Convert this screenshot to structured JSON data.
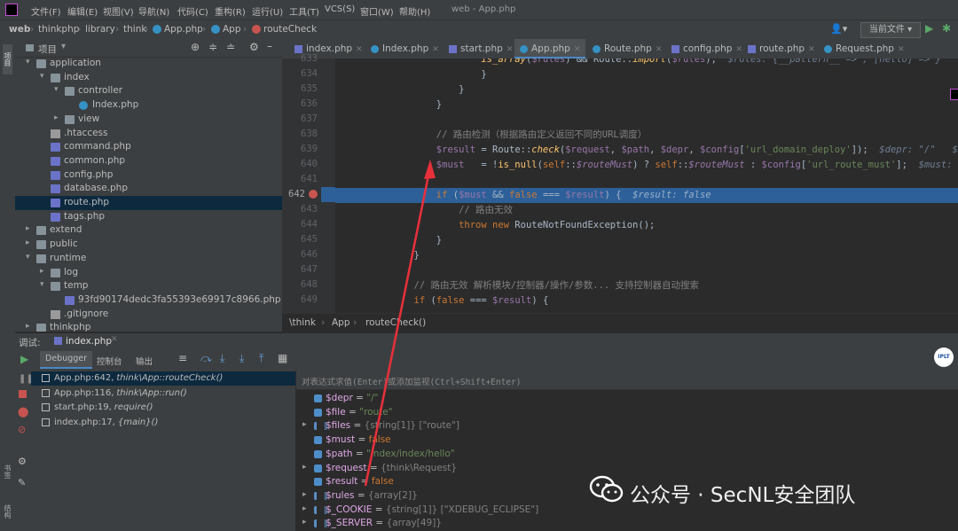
{
  "menu": {
    "items": [
      "文件(F)",
      "编辑(E)",
      "视图(V)",
      "导航(N)",
      "代码(C)",
      "重构(R)",
      "运行(U)",
      "工具(T)",
      "VCS(S)",
      "窗口(W)",
      "帮助(H)"
    ],
    "window_title": "web - App.php"
  },
  "navbar": {
    "crumbs": [
      "web",
      "thinkphp",
      "library",
      "think",
      "App.php",
      "App",
      "routeCheck"
    ],
    "run_config": "当前文件"
  },
  "project": {
    "header": "项目",
    "tree": [
      {
        "label": "application",
        "indent": 2,
        "arrow": "▾",
        "icon": "folder"
      },
      {
        "label": "index",
        "indent": 3,
        "arrow": "▾",
        "icon": "folder"
      },
      {
        "label": "controller",
        "indent": 4,
        "arrow": "▾",
        "icon": "folder"
      },
      {
        "label": "Index.php",
        "indent": 5,
        "arrow": "",
        "icon": "class"
      },
      {
        "label": "view",
        "indent": 4,
        "arrow": "▸",
        "icon": "folder"
      },
      {
        "label": ".htaccess",
        "indent": 3,
        "arrow": "",
        "icon": "text"
      },
      {
        "label": "command.php",
        "indent": 3,
        "arrow": "",
        "icon": "php"
      },
      {
        "label": "common.php",
        "indent": 3,
        "arrow": "",
        "icon": "php"
      },
      {
        "label": "config.php",
        "indent": 3,
        "arrow": "",
        "icon": "php"
      },
      {
        "label": "database.php",
        "indent": 3,
        "arrow": "",
        "icon": "php"
      },
      {
        "label": "route.php",
        "indent": 3,
        "arrow": "",
        "icon": "php",
        "selected": true
      },
      {
        "label": "tags.php",
        "indent": 3,
        "arrow": "",
        "icon": "php"
      },
      {
        "label": "extend",
        "indent": 2,
        "arrow": "▸",
        "icon": "folder"
      },
      {
        "label": "public",
        "indent": 2,
        "arrow": "▸",
        "icon": "folder"
      },
      {
        "label": "runtime",
        "indent": 2,
        "arrow": "▾",
        "icon": "folder"
      },
      {
        "label": "log",
        "indent": 3,
        "arrow": "▸",
        "icon": "folder"
      },
      {
        "label": "temp",
        "indent": 3,
        "arrow": "▾",
        "icon": "folder"
      },
      {
        "label": "93fd90174dedc3fa55393e69917c8966.php",
        "indent": 4,
        "arrow": "",
        "icon": "php"
      },
      {
        "label": ".gitignore",
        "indent": 3,
        "arrow": "",
        "icon": "text"
      },
      {
        "label": "thinkphp",
        "indent": 2,
        "arrow": "▸",
        "icon": "folder"
      }
    ]
  },
  "tabs": [
    {
      "label": "index.php",
      "icon": "php"
    },
    {
      "label": "Index.php",
      "icon": "class"
    },
    {
      "label": "start.php",
      "icon": "php"
    },
    {
      "label": "App.php",
      "icon": "class",
      "active": true
    },
    {
      "label": "Route.php",
      "icon": "class"
    },
    {
      "label": "config.php",
      "icon": "php"
    },
    {
      "label": "route.php",
      "icon": "php"
    },
    {
      "label": "Request.php",
      "icon": "class"
    }
  ],
  "editor": {
    "line_numbers": [
      "633",
      "634",
      "635",
      "636",
      "637",
      "638",
      "639",
      "640",
      "641",
      "642",
      "643",
      "644",
      "645",
      "646",
      "647",
      "648",
      "649"
    ],
    "breadcrumb": [
      "\\think",
      "App",
      "routeCheck()"
    ],
    "breakpoint_line": "642"
  },
  "debug": {
    "title": "调试:",
    "session": "index.php",
    "tabs": [
      "Debugger",
      "控制台",
      "输出"
    ],
    "eval_placeholder": "对表达式求值(Enter)或添加监视(Ctrl+Shift+Enter)",
    "frames": [
      {
        "file": "App.php:642,",
        "call": "think\\App::routeCheck()",
        "selected": true
      },
      {
        "file": "App.php:116,",
        "call": "think\\App::run()"
      },
      {
        "file": "start.php:19,",
        "call": "require()"
      },
      {
        "file": "index.php:17,",
        "call": "{main}()"
      }
    ],
    "vars": [
      {
        "name": "$depr",
        "eq": " = ",
        "value": "\"/\"",
        "type": "str",
        "expand": false
      },
      {
        "name": "$file",
        "eq": " = ",
        "value": "\"route\"",
        "type": "str",
        "expand": false
      },
      {
        "name": "$files",
        "eq": " = ",
        "value": "{string[1]} [\"route\"]",
        "type": "arr",
        "expand": true
      },
      {
        "name": "$must",
        "eq": " = ",
        "value": "false",
        "type": "kw",
        "expand": false
      },
      {
        "name": "$path",
        "eq": " = ",
        "value": "\"index/index/hello\"",
        "type": "str",
        "expand": false
      },
      {
        "name": "$request",
        "eq": " = ",
        "value": "{think\\Request}",
        "type": "obj",
        "expand": true
      },
      {
        "name": "$result",
        "eq": " = ",
        "value": "false",
        "type": "kw",
        "expand": false
      },
      {
        "name": "$rules",
        "eq": " = ",
        "value": "{array[2]}",
        "type": "arr",
        "expand": true
      },
      {
        "name": "$_COOKIE",
        "eq": " = ",
        "value": "{string[1]} [\"XDEBUG_ECLIPSE\"]",
        "type": "arr",
        "expand": true
      },
      {
        "name": "$_SERVER",
        "eq": " = ",
        "value": "{array[49]}",
        "type": "arr",
        "expand": true
      }
    ]
  },
  "watermark": {
    "text": "公众号 · SecNL安全团队"
  },
  "side_labels": {
    "project_strip": "项目",
    "bookmark_strip": "书签",
    "structure_strip": "结构"
  }
}
